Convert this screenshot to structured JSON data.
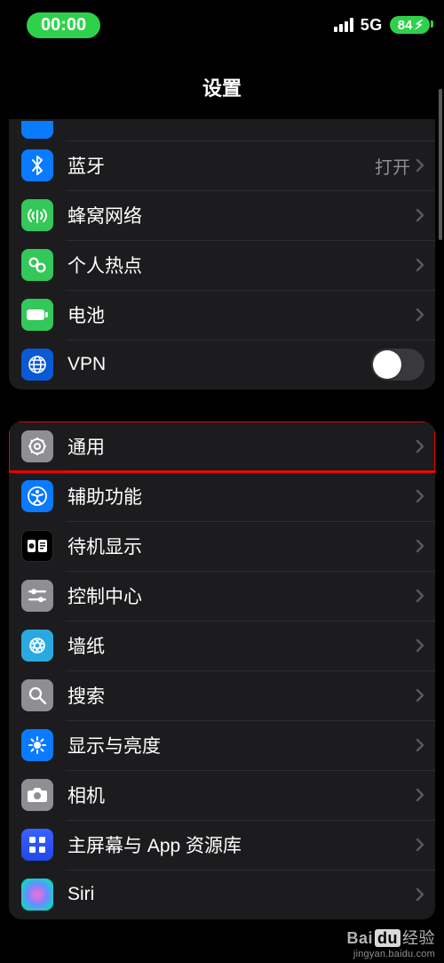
{
  "status": {
    "time": "00:00",
    "network": "5G",
    "battery": "84"
  },
  "title": "设置",
  "group1": {
    "bluetooth": {
      "label": "蓝牙",
      "value": "打开"
    },
    "cellular": {
      "label": "蜂窝网络"
    },
    "hotspot": {
      "label": "个人热点"
    },
    "battery": {
      "label": "电池"
    },
    "vpn": {
      "label": "VPN"
    }
  },
  "group2": {
    "general": {
      "label": "通用"
    },
    "accessibility": {
      "label": "辅助功能"
    },
    "standby": {
      "label": "待机显示"
    },
    "controlcenter": {
      "label": "控制中心"
    },
    "wallpaper": {
      "label": "墙纸"
    },
    "search": {
      "label": "搜索"
    },
    "display": {
      "label": "显示与亮度"
    },
    "camera": {
      "label": "相机"
    },
    "homescreen": {
      "label": "主屏幕与 App 资源库"
    },
    "siri": {
      "label": "Siri"
    }
  },
  "watermark": {
    "brand_a": "Bai",
    "brand_b": "du",
    "brand_c": "经验",
    "url": "jingyan.baidu.com"
  }
}
